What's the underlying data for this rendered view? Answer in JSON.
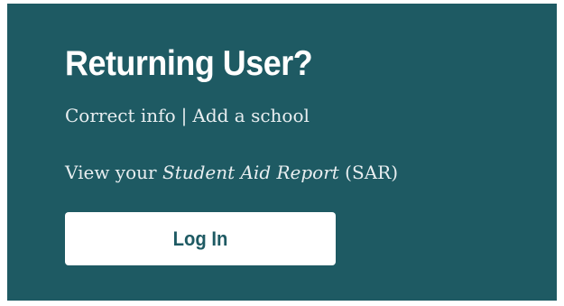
{
  "card": {
    "title": "Returning User?",
    "links": {
      "correct_info": "Correct info",
      "separator": "|",
      "add_school": "Add a school"
    },
    "sar": {
      "prefix": "View your ",
      "report_name": "Student Aid Report",
      "suffix": " (SAR)"
    },
    "login_label": "Log In"
  },
  "colors": {
    "card_background": "#1e5a63",
    "button_background": "#ffffff",
    "button_text": "#1e5a63"
  }
}
